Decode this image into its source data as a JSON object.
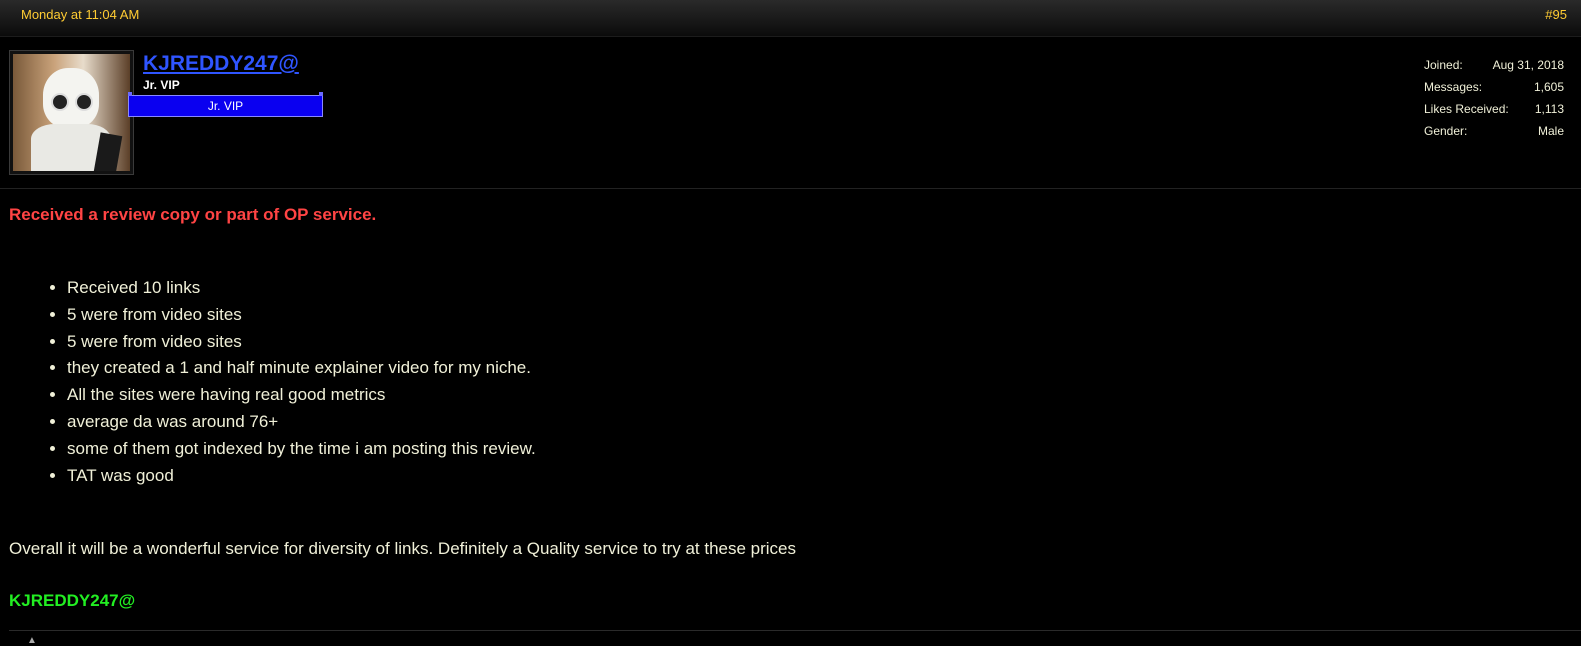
{
  "post": {
    "date": "Monday at 11:04 AM",
    "number": "#95"
  },
  "user": {
    "name": "KJREDDY247@",
    "title": "Jr. VIP",
    "badge": "Jr. VIP"
  },
  "stats": [
    {
      "label": "Joined:",
      "value": "Aug 31, 2018"
    },
    {
      "label": "Messages:",
      "value": "1,605"
    },
    {
      "label": "Likes Received:",
      "value": "1,113"
    },
    {
      "label": "Gender:",
      "value": "Male"
    }
  ],
  "content": {
    "notice": "Received a review copy or part of OP service.",
    "bullets": [
      "Received 10 links",
      "5 were from video sites",
      "5 were from video sites",
      "they created a 1 and half minute explainer video for my niche.",
      "All the sites were having real good metrics",
      "average da was around 76+",
      "some of them got indexed by the time i am posting this review.",
      "TAT was good"
    ],
    "summary": "Overall it will be a wonderful service for diversity of links. Definitely a Quality service to try at these prices",
    "signature": "KJREDDY247@"
  },
  "colors": {
    "accent": "#ffcc33",
    "username": "#2f55ff",
    "notice": "#ff4444",
    "signature": "#22ee22",
    "badge": "#0a00f0"
  }
}
